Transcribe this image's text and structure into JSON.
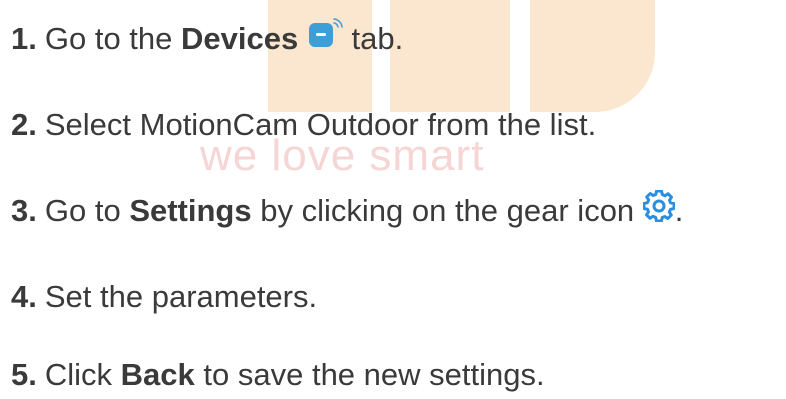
{
  "watermark": {
    "text": "we love smart"
  },
  "steps": [
    {
      "number": "1.",
      "before": "Go to the",
      "bold": "Devices",
      "icon": "devices-icon",
      "after": "tab."
    },
    {
      "number": "2.",
      "text": "Select MotionCam Outdoor from the list."
    },
    {
      "number": "3.",
      "before": "Go to",
      "bold": "Settings",
      "middle": "by clicking on the gear icon",
      "icon": "gear-icon",
      "after": "."
    },
    {
      "number": "4.",
      "text": "Set the parameters."
    },
    {
      "number": "5.",
      "before": "Click",
      "bold": "Back",
      "after": "to save the new settings."
    }
  ],
  "colors": {
    "text": "#3a3a3a",
    "devices_icon": "#3d9fd7",
    "gear_icon": "#2b8fe0",
    "watermark_block": "#fbe6cf",
    "watermark_text": "#f6d5d5"
  }
}
